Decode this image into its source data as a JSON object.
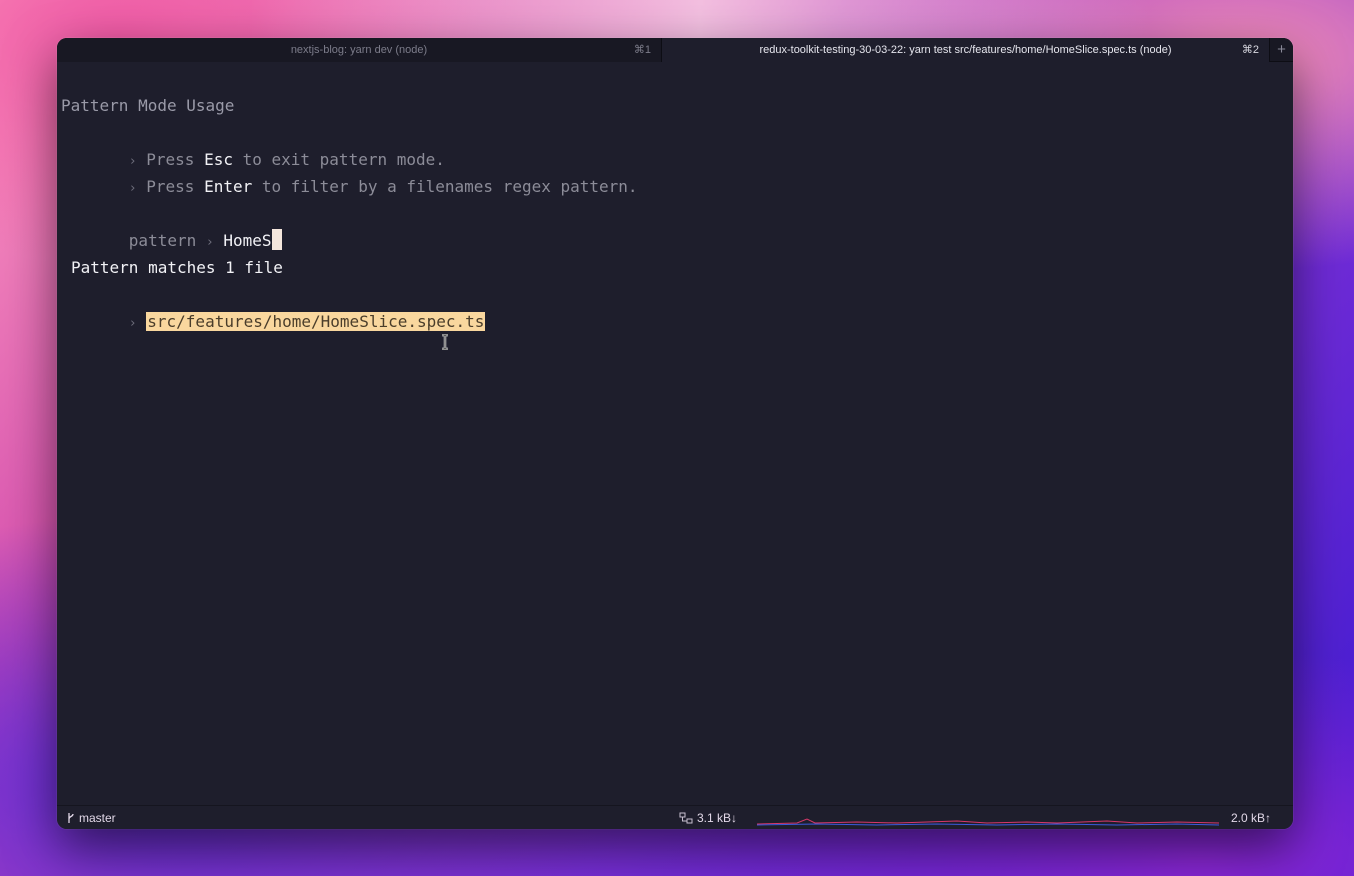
{
  "tabs": [
    {
      "title": "nextjs-blog: yarn dev (node)",
      "shortcut": "⌘1",
      "active": false
    },
    {
      "title": "redux-toolkit-testing-30-03-22: yarn test src/features/home/HomeSlice.spec.ts (node)",
      "shortcut": "⌘2",
      "active": true
    }
  ],
  "new_tab_glyph": "+",
  "terminal": {
    "heading": "Pattern Mode Usage",
    "bullet": "›",
    "hints": [
      {
        "pre": "Press ",
        "key": "Esc",
        "post": " to exit pattern mode."
      },
      {
        "pre": "Press ",
        "key": "Enter",
        "post": " to filter by a filenames regex pattern."
      }
    ],
    "prompt_label": "pattern",
    "prompt_sep": "›",
    "prompt_value": "HomeS",
    "result_heading": "Pattern matches 1 file",
    "matches": [
      "src/features/home/HomeSlice.spec.ts"
    ]
  },
  "status": {
    "branch_icon": "git-branch-icon",
    "branch": "master",
    "download_icon": "network-icon",
    "download": "3.1 kB↓",
    "upload": "2.0 kB↑"
  },
  "colors": {
    "terminal_bg": "#1e1e2c",
    "match_highlight": "#f9d79e",
    "cursor": "#f4e6dc"
  }
}
